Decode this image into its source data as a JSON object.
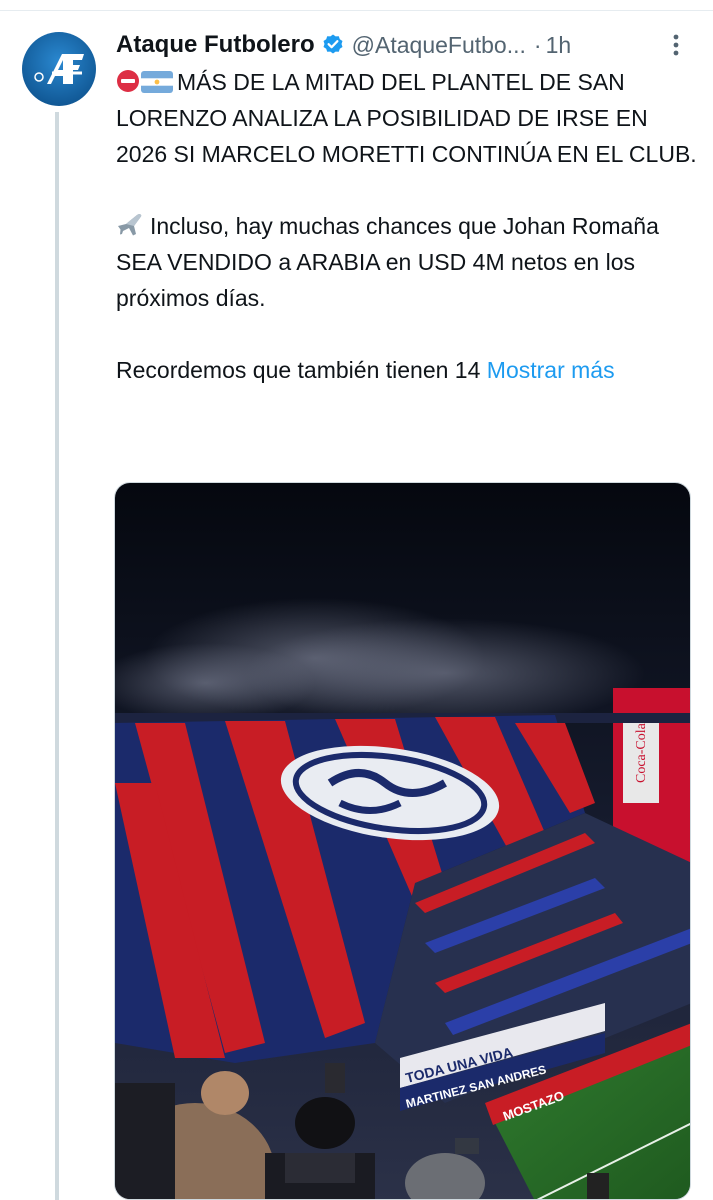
{
  "tweet": {
    "author_name": "Ataque Futbolero",
    "handle": "@AtaqueFutbo...",
    "separator": "·",
    "time": "1h",
    "paragraph1": "MÁS DE LA MITAD DEL PLANTEL DE SAN LORENZO ANALIZA LA POSIBILIDAD DE IRSE EN 2026 SI MARCELO MORETTI CONTINÚA EN EL CLUB.",
    "paragraph2": "Incluso, hay muchas chances que Johan Romaña SEA VENDIDO a ARABIA en USD 4M netos en los próximos días.",
    "paragraph3": "Recordemos que también tienen 14",
    "show_more": "Mostrar más",
    "emojis": [
      "no-entry",
      "argentina-flag",
      "airplane"
    ]
  },
  "avatar": {
    "logo_text": "AF",
    "brand_color": "#1a73b8"
  },
  "media": {
    "banner_text": "Coca-Cola",
    "mural_line1": "TODA UNA VIDA",
    "mural_line2": "MARTINEZ SAN ANDRES",
    "ad_board": "MOSTAZO"
  },
  "colors": {
    "link": "#1d9bf0",
    "verified": "#1d9bf0",
    "secondary_text": "#536471",
    "thread_line": "#cfd9de"
  }
}
